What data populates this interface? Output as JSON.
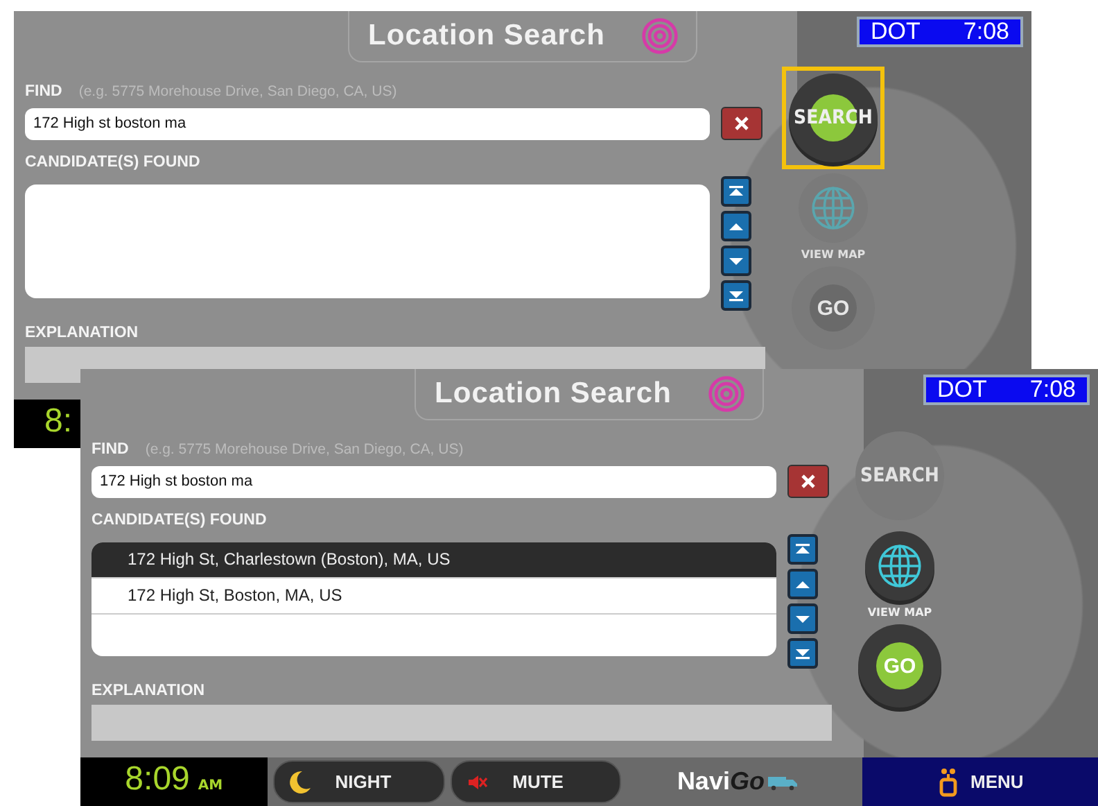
{
  "screens": [
    {
      "title": "Location Search",
      "status": {
        "label": "DOT",
        "time": "7:08"
      },
      "find": {
        "label": "FIND",
        "hint": "(e.g. 5775 Morehouse Drive, San Diego, CA, US)",
        "value": "172 High st boston ma"
      },
      "candidates_label": "CANDIDATE(S) FOUND",
      "explanation_label": "EXPLANATION",
      "actions": [
        {
          "kind": "search",
          "label": "SEARCH",
          "enabled": true,
          "highlighted": true
        },
        {
          "kind": "view_map",
          "label": "VIEW MAP",
          "enabled": false
        },
        {
          "kind": "go",
          "label": "GO",
          "enabled": false
        }
      ],
      "bottom_bar": {
        "clock": "8:"
      }
    },
    {
      "title": "Location Search",
      "status": {
        "label": "DOT",
        "time": "7:08"
      },
      "find": {
        "label": "FIND",
        "hint": "(e.g. 5775 Morehouse Drive, San Diego, CA, US)",
        "value": "172 High st boston ma"
      },
      "candidates_label": "CANDIDATE(S) FOUND",
      "candidates": [
        {
          "text": "172 High St, Charlestown (Boston), MA, US",
          "selected": true
        },
        {
          "text": "172 High St, Boston, MA, US",
          "selected": false
        }
      ],
      "explanation_label": "EXPLANATION",
      "actions": [
        {
          "kind": "search",
          "label": "SEARCH",
          "enabled": false,
          "highlighted": false
        },
        {
          "kind": "view_map",
          "label": "VIEW MAP",
          "enabled": true
        },
        {
          "kind": "go",
          "label": "GO",
          "enabled": true
        }
      ],
      "bottom_bar": {
        "clock": "8:09",
        "meridiem": "AM",
        "night": "NIGHT",
        "mute": "MUTE",
        "logo_light": "Navi",
        "logo_dark": "Go",
        "menu": "MENU"
      }
    }
  ]
}
